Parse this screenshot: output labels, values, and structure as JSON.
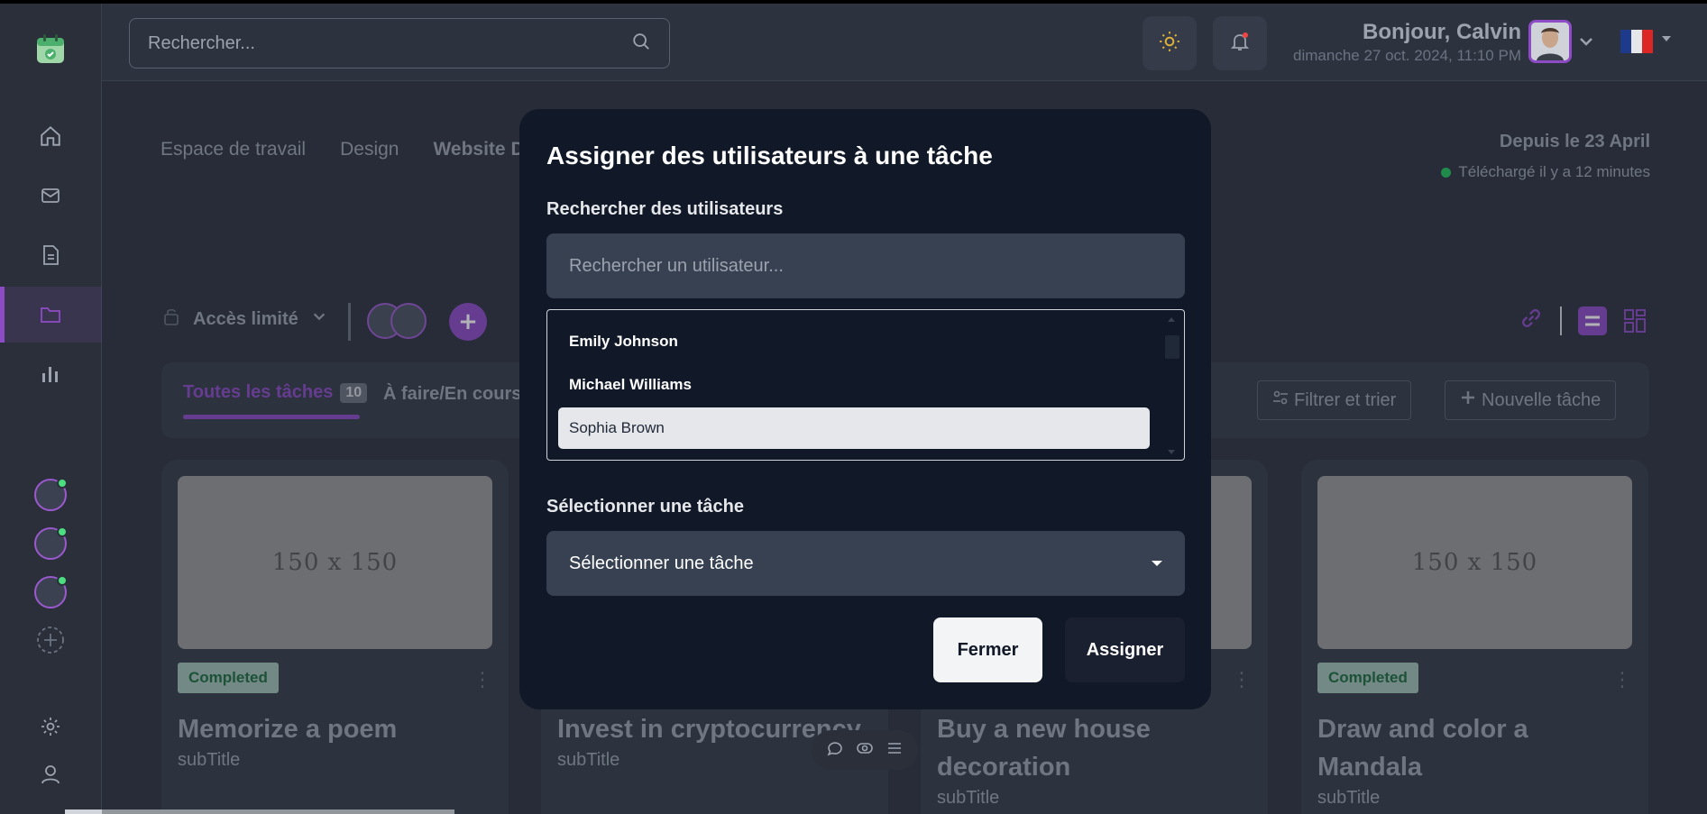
{
  "header": {
    "search_placeholder": "Rechercher...",
    "greeting": "Bonjour, Calvin",
    "datetime": "dimanche 27 oct. 2024, 11:10 PM"
  },
  "breadcrumbs": [
    "Espace de travail",
    "Design",
    "Website D"
  ],
  "project_info": {
    "since": "Depuis le 23 April",
    "uploaded": "Téléchargé il y a 12 minutes"
  },
  "access": {
    "label": "Accès limité"
  },
  "tabs": {
    "all_label": "Toutes les tâches",
    "all_count": "10",
    "todo_label": "À faire/En cours"
  },
  "toolbar": {
    "filter_label": "Filtrer et trier",
    "new_task_label": "Nouvelle tâche"
  },
  "cards": [
    {
      "image_label": "150 x 150",
      "status": "Completed",
      "title": "Memorize a poem",
      "subtitle": "subTitle"
    },
    {
      "image_label": "",
      "status": "",
      "title": "Invest in cryptocurrency",
      "subtitle": "subTitle"
    },
    {
      "image_label": "",
      "status": "",
      "title": "Buy a new house decoration",
      "subtitle": "subTitle"
    },
    {
      "image_label": "150 x 150",
      "status": "Completed",
      "title": "Draw and color a Mandala",
      "subtitle": "subTitle"
    }
  ],
  "modal": {
    "title": "Assigner des utilisateurs à une tâche",
    "search_label": "Rechercher des utilisateurs",
    "search_placeholder": "Rechercher un utilisateur...",
    "users": [
      "Emily Johnson",
      "Michael Williams",
      "Sophia Brown"
    ],
    "selected_user": "Sophia Brown",
    "task_label": "Sélectionner une tâche",
    "task_select_value": "Sélectionner une tâche",
    "close_label": "Fermer",
    "assign_label": "Assigner"
  },
  "colors": {
    "accent": "#8e4bc6",
    "online": "#22c55e",
    "modal_bg": "#111827"
  }
}
